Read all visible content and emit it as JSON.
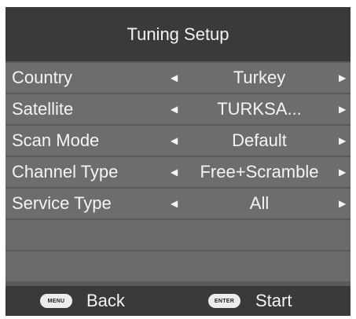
{
  "title": "Tuning Setup",
  "rows": [
    {
      "label": "Country",
      "value": "Turkey"
    },
    {
      "label": "Satellite",
      "value": "TURKSA..."
    },
    {
      "label": "Scan Mode",
      "value": "Default"
    },
    {
      "label": "Channel Type",
      "value": "Free+Scramble"
    },
    {
      "label": "Service Type",
      "value": "All"
    }
  ],
  "icons": {
    "left_arrow": "triangle-left-icon",
    "right_arrow": "triangle-right-icon"
  },
  "footer": {
    "back_key": "MENU",
    "back_label": "Back",
    "start_key": "ENTER",
    "start_label": "Start"
  },
  "colors": {
    "panel": "#5a5a5a",
    "title_bar": "#3a3a3a",
    "row": "#6d6d6d",
    "text": "#f4f4f4",
    "pill": "#ececec"
  }
}
